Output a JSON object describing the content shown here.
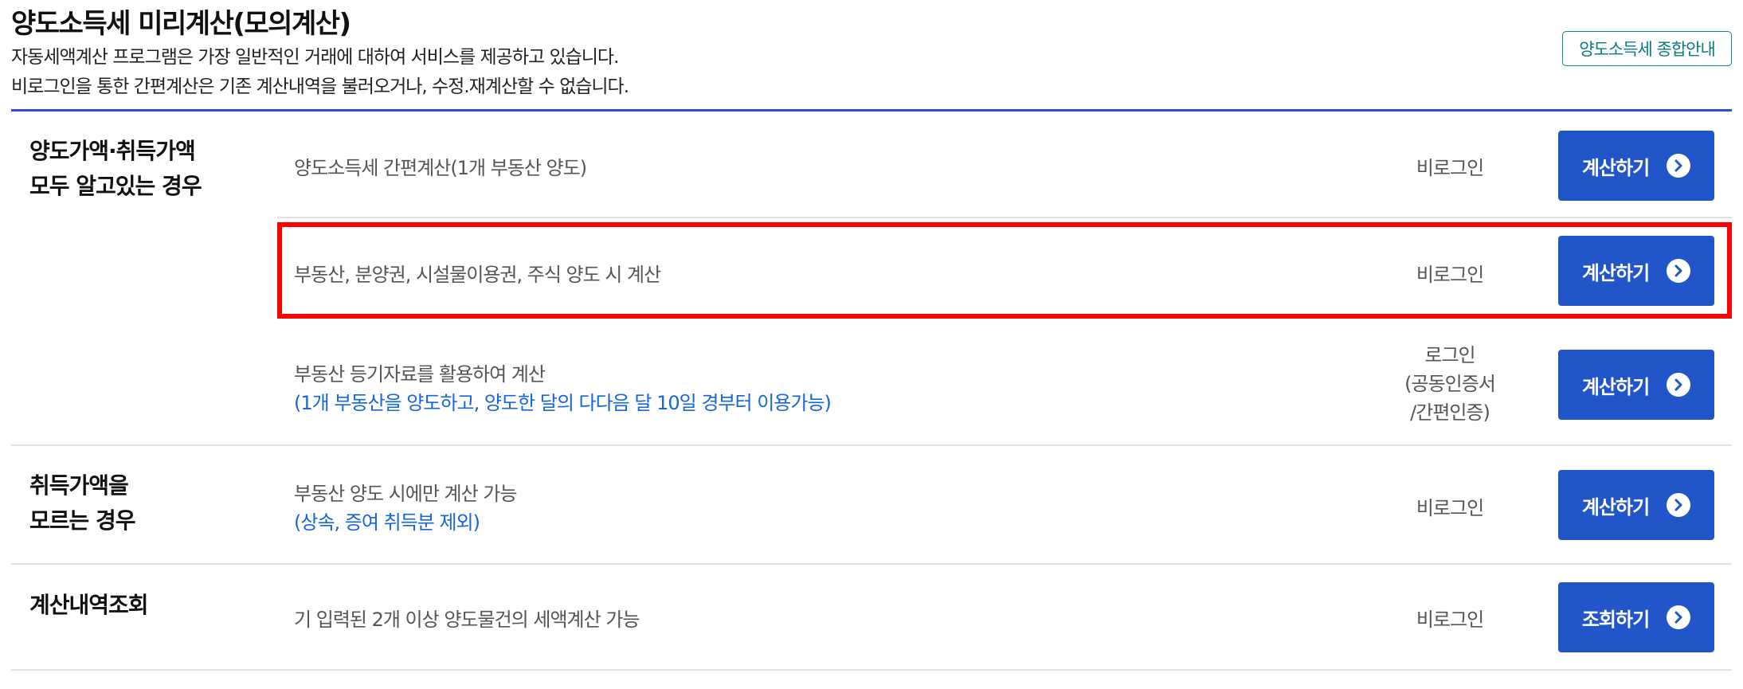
{
  "header": {
    "title": "양도소득세 미리계산(모의계산)",
    "desc_line1": "자동세액계산 프로그램은 가장 일반적인 거래에 대하여 서비스를 제공하고 있습니다.",
    "desc_line2": "비로그인을 통한 간편계산은 기존 계산내역을 불러오거나, 수정.재계산할 수 없습니다.",
    "guide_button": "양도소득세 종합안내"
  },
  "colors": {
    "accent_blue": "#2255c8",
    "rule_blue": "#3346d4",
    "link_blue": "#1566d6",
    "teal": "#0b7b7b",
    "highlight_red": "#ff0000"
  },
  "sections": [
    {
      "category_line1": "양도가액·취득가액",
      "category_line2": "모두 알고있는 경우",
      "rows": [
        {
          "text": "양도소득세 간편계산(1개 부동산 양도)",
          "login": "비로그인",
          "button": "계산하기"
        },
        {
          "text": "부동산, 분양권, 시설물이용권, 주식 양도 시 계산",
          "login": "비로그인",
          "button": "계산하기"
        },
        {
          "text": "부동산 등기자료를 활용하여 계산",
          "subtext": "(1개 부동산을 양도하고, 양도한 달의 다다음 달 10일 경부터 이용가능)",
          "login_line1": "로그인",
          "login_line2": "(공동인증서",
          "login_line3": "/간편인증)",
          "button": "계산하기"
        }
      ]
    },
    {
      "category_line1": "취득가액을",
      "category_line2": "모르는 경우",
      "rows": [
        {
          "text": "부동산 양도 시에만 계산 가능",
          "subtext": "(상속, 증여 취득분 제외)",
          "login": "비로그인",
          "button": "계산하기"
        }
      ]
    },
    {
      "category_line1": "계산내역조회",
      "rows": [
        {
          "text": "기 입력된 2개 이상 양도물건의 세액계산 가능",
          "login": "비로그인",
          "button": "조회하기"
        }
      ]
    }
  ]
}
